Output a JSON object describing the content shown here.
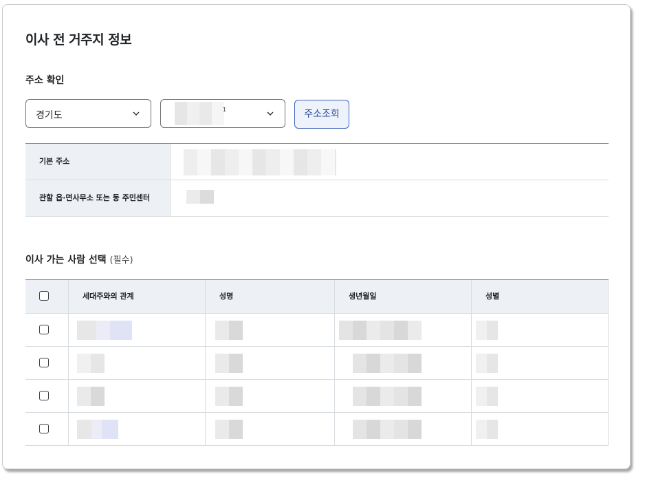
{
  "section_title": "이사 전 거주지 정보",
  "address_check": {
    "heading": "주소 확인",
    "province_select": {
      "value": "경기도"
    },
    "city_select": {
      "value": "1"
    },
    "lookup_button": "주소조회"
  },
  "address_info": {
    "rows": [
      {
        "label": "기본 주소"
      },
      {
        "label": "관할 읍·면사무소 또는 동 주민센터"
      }
    ]
  },
  "movers": {
    "heading": "이사 가는 사람 선택",
    "required_note": "(필수)",
    "columns": [
      "세대주와의 관계",
      "성명",
      "생년월일",
      "성별"
    ],
    "row_count": 4
  },
  "icons": {
    "chevron": "chevron-down-icon",
    "checkbox": "checkbox-icon"
  },
  "colors": {
    "accent": "#3a63b8",
    "header_bg": "#edf1f6",
    "border": "#d9dce0"
  }
}
